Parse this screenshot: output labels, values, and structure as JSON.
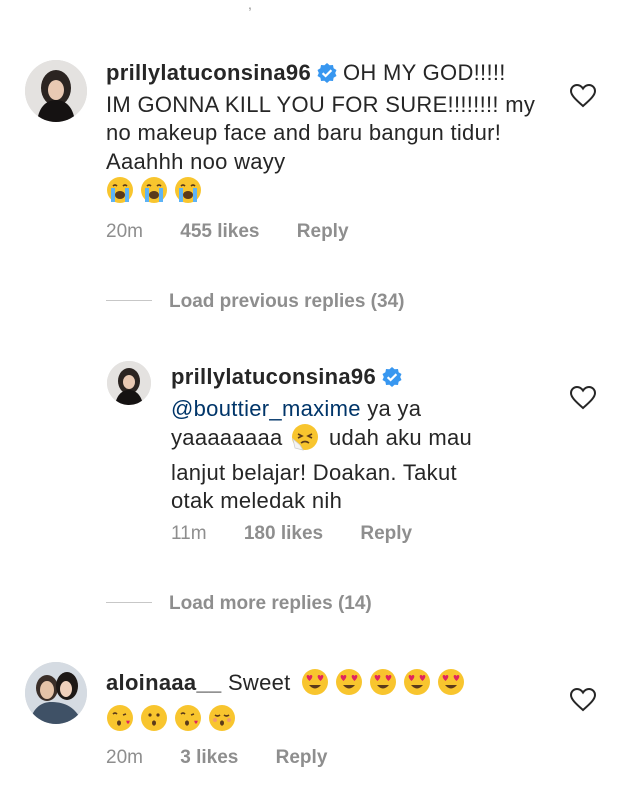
{
  "top_fragment": ",",
  "comments": [
    {
      "username": "prillylatuconsina96",
      "verified": true,
      "text": "OH MY GOD!!!!! IM GONNA KILL YOU FOR SURE!!!!!!!! my no makeup face and baru bangun tidur! Aaahhh noo wayy",
      "emojis": [
        "crying-emoji",
        "crying-emoji",
        "crying-emoji"
      ],
      "time": "20m",
      "likes": "455 likes",
      "reply": "Reply"
    },
    {
      "load_label": "Load previous replies (34)"
    },
    {
      "username": "prillylatuconsina96",
      "verified": true,
      "mention": "@bouttier_maxime",
      "text_a": "ya ya",
      "text_b": "yaaaaaaaa",
      "text_c": "udah aku mau",
      "text_d": "lanjut belajar! Doakan. Takut",
      "text_e": "otak meledak nih",
      "time": "11m",
      "likes": "180 likes",
      "reply": "Reply"
    },
    {
      "load_label": "Load more replies (14)"
    },
    {
      "username": "aloinaaa__",
      "text": "Sweet",
      "time": "20m",
      "likes": "3 likes",
      "reply": "Reply"
    }
  ]
}
